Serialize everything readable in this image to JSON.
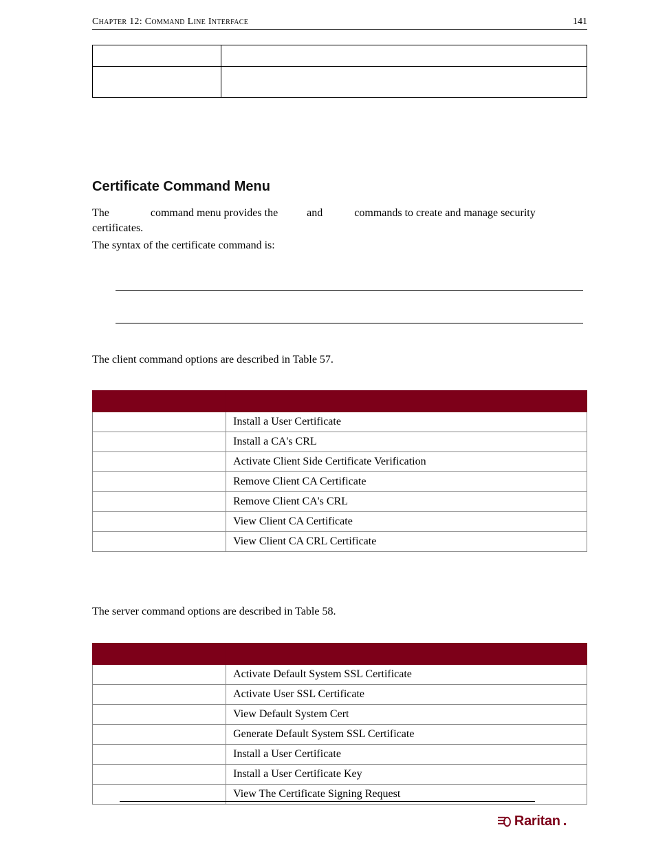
{
  "header": {
    "chapter": "Chapter 12: Command Line Interface",
    "page": "141"
  },
  "section": {
    "heading": "Certificate Command Menu",
    "para1_a": "The ",
    "para1_b": " command menu provides the ",
    "para1_c": " and ",
    "para1_d": " commands to create and manage security certificates.",
    "para2": "The syntax of the certificate command is:",
    "para3": "The client command options are described in Table 57.",
    "para4": "The server command options are described in Table 58."
  },
  "table57": {
    "rows": [
      {
        "desc": "Install a User Certificate"
      },
      {
        "desc": "Install a CA's CRL"
      },
      {
        "desc": "Activate Client Side Certificate Verification"
      },
      {
        "desc": "Remove Client CA Certificate"
      },
      {
        "desc": "Remove Client CA's CRL"
      },
      {
        "desc": "View Client CA Certificate"
      },
      {
        "desc": "View Client CA CRL Certificate"
      }
    ]
  },
  "table58": {
    "rows": [
      {
        "desc": "Activate Default System SSL Certificate"
      },
      {
        "desc": "Activate User SSL Certificate"
      },
      {
        "desc": "View Default System Cert"
      },
      {
        "desc": "Generate Default System SSL Certificate"
      },
      {
        "desc": "Install a User Certificate"
      },
      {
        "desc": "Install a User Certificate Key"
      },
      {
        "desc": "View The Certificate Signing Request"
      }
    ]
  },
  "footer": {
    "brand": "Raritan"
  }
}
